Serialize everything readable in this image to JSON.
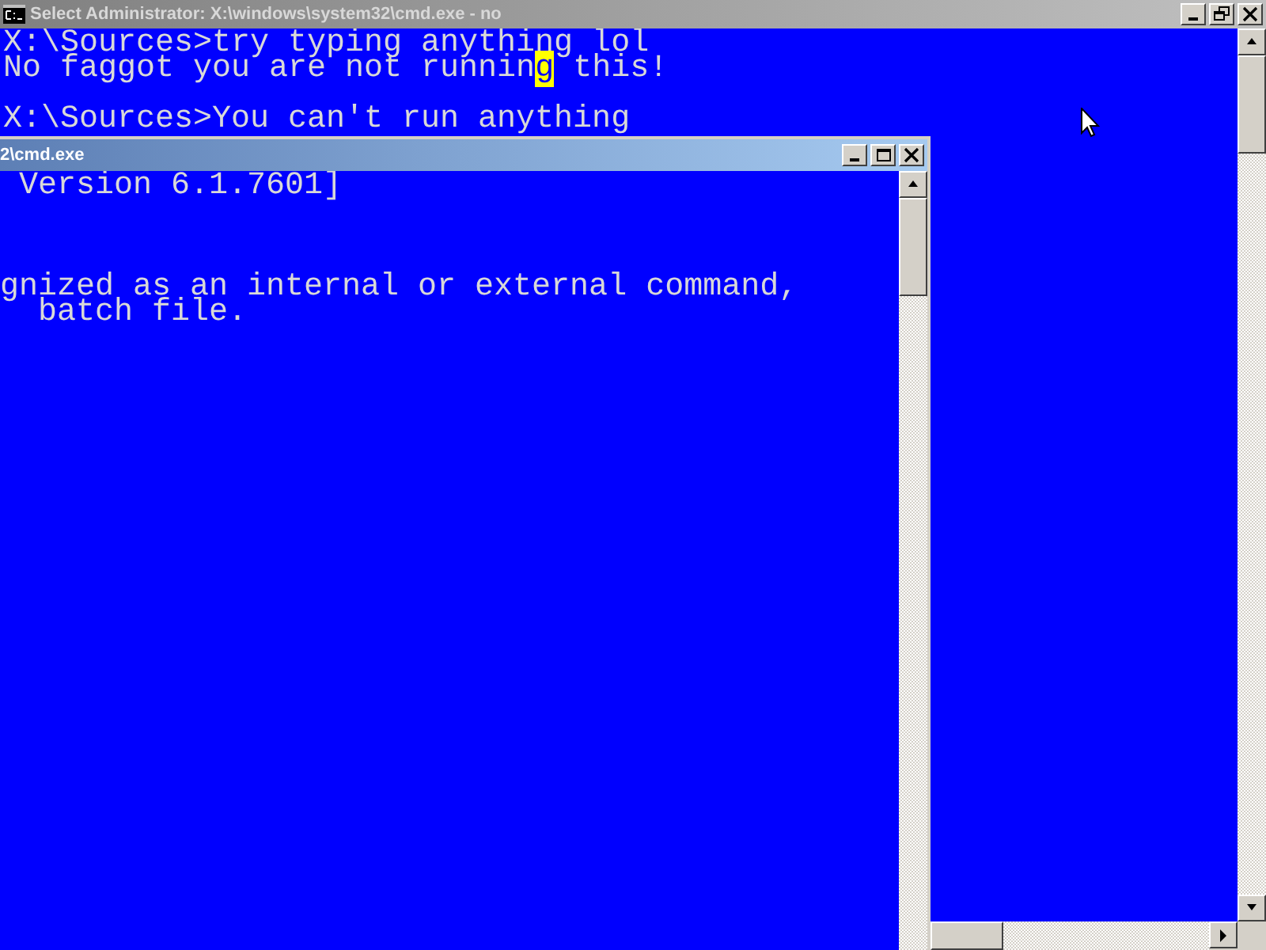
{
  "windows": [
    {
      "title": "Select Administrator: X:\\windows\\system32\\cmd.exe - no",
      "active": false,
      "maximized": true,
      "lines": [
        {
          "kind": "text",
          "segments": [
            {
              "text": "X:\\Sources>try typing anything lol",
              "selected": false
            }
          ]
        },
        {
          "kind": "text",
          "segments": [
            {
              "text": "No faggot you are not runnin",
              "selected": false
            },
            {
              "text": "g",
              "selected": true
            },
            {
              "text": " this!",
              "selected": false
            }
          ]
        },
        {
          "kind": "blank"
        },
        {
          "kind": "text",
          "segments": [
            {
              "text": "X:\\Sources>You can't run anything",
              "selected": false
            }
          ]
        }
      ]
    },
    {
      "title": "2\\cmd.exe",
      "active": true,
      "maximized": false,
      "lines": [
        {
          "kind": "text",
          "segments": [
            {
              "text": " Version 6.1.7601]",
              "selected": false
            }
          ]
        },
        {
          "kind": "blank"
        },
        {
          "kind": "blank"
        },
        {
          "kind": "blank"
        },
        {
          "kind": "text",
          "segments": [
            {
              "text": "gnized as an internal or external command,",
              "selected": false
            }
          ]
        },
        {
          "kind": "text",
          "segments": [
            {
              "text": "  batch file.",
              "selected": false
            }
          ]
        }
      ]
    }
  ]
}
